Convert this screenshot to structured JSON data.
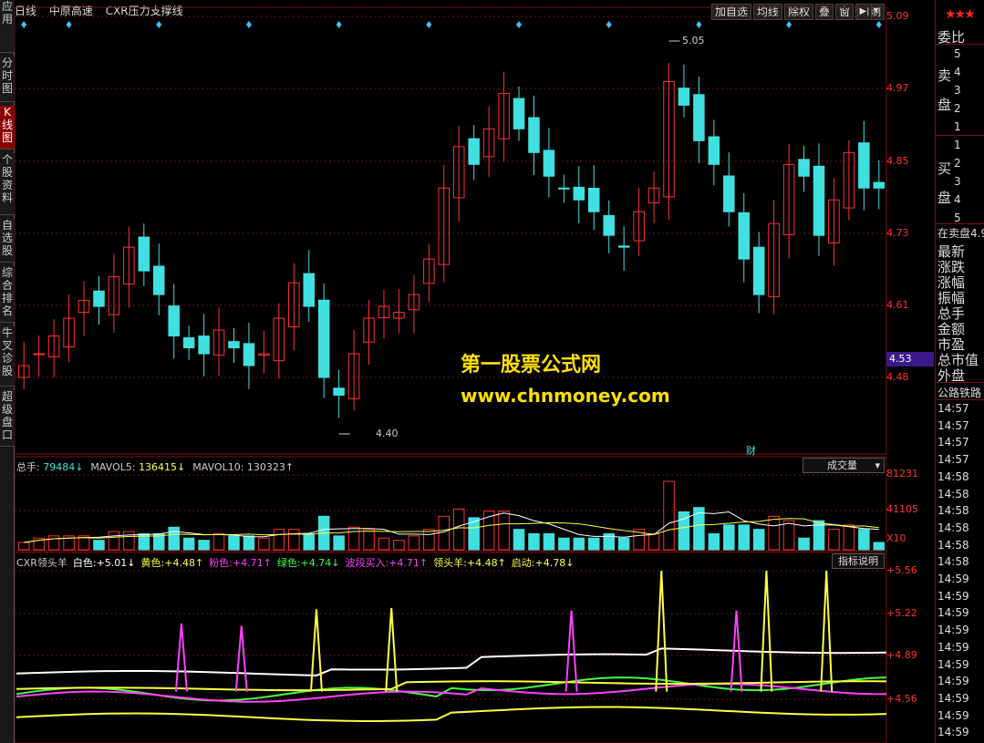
{
  "top": {
    "period": "日线",
    "stock": "中原高速",
    "formula": "CXR压力支撑线"
  },
  "buttons": [
    "加自选",
    "均线",
    "除权",
    "叠",
    "窗",
    "预测"
  ],
  "left_tabs": [
    "应用",
    "分时图",
    "K线图",
    "个股资料",
    "自选股",
    "综合排名",
    "牛叉诊股",
    "超级盘口"
  ],
  "price_axis": [
    "5.09",
    "4.97",
    "4.85",
    "4.73",
    "4.61",
    "4.48"
  ],
  "current_price": "4.53",
  "annotations": {
    "high": "5.05",
    "low": "4.40",
    "cai": "财"
  },
  "volume": {
    "header_items": [
      {
        "label": "总手:",
        "value": "79484↓"
      },
      {
        "label": "MAVOL5:",
        "value": "136415↓"
      },
      {
        "label": "MAVOL10:",
        "value": "130323↑"
      }
    ],
    "axis": [
      "81231",
      "41105",
      "X10"
    ],
    "selector": "成交量"
  },
  "indicator": {
    "name": "CXR领头羊",
    "header_items": [
      {
        "label": "白色:",
        "value": "+5.01↓",
        "color": "#ffffff"
      },
      {
        "label": "黄色:",
        "value": "+4.48↑",
        "color": "#ffff40"
      },
      {
        "label": "粉色:",
        "value": "+4.71↑",
        "color": "#ff40ff"
      },
      {
        "label": "绿色:",
        "value": "+4.74↓",
        "color": "#40ff40"
      },
      {
        "label": "波段买入:",
        "value": "+4.71↑",
        "color": "#ff40ff"
      },
      {
        "label": "领头羊:",
        "value": "+4.48↑",
        "color": "#ffff40"
      },
      {
        "label": "启动:",
        "value": "+4.78↓",
        "color": "#ffff40"
      }
    ],
    "axis": [
      "+5.56",
      "+5.22",
      "+4.89",
      "+4.56"
    ],
    "help": "指标说明"
  },
  "watermark": {
    "line1": "第一股票公式网",
    "line2": "www.chnmoney.com"
  },
  "right_panel": {
    "weibi": "委比",
    "sell_label": [
      "卖",
      "盘"
    ],
    "sell_levels": [
      "5",
      "4",
      "3",
      "2",
      "1"
    ],
    "buy_label": [
      "买",
      "盘"
    ],
    "buy_levels": [
      "1",
      "2",
      "3",
      "4",
      "5"
    ],
    "zaimai": "在卖盘4.9",
    "stats": [
      "最新",
      "涨跌",
      "涨幅",
      "振幅",
      "总手",
      "金额",
      "市盈",
      "总市值",
      "外盘"
    ],
    "ticker_header": "公路铁路",
    "times": [
      "14:57",
      "14:57",
      "14:57",
      "14:57",
      "14:58",
      "14:58",
      "14:58",
      "14:58",
      "14:58",
      "14:58",
      "14:59",
      "14:59",
      "14:59",
      "14:59",
      "14:59",
      "14:59",
      "14:59",
      "14:59",
      "14:59",
      "14:59"
    ]
  },
  "colors": {
    "up": "#ff3030",
    "down": "#40e0e0",
    "grid": "#7a1010",
    "white": "#ffffff",
    "yellow": "#ffff40",
    "pink": "#ff40ff",
    "green": "#40ff40"
  },
  "chart_data": {
    "type": "candlestick",
    "close_estimates": [
      4.5,
      4.52,
      4.55,
      4.58,
      4.61,
      4.6,
      4.65,
      4.7,
      4.66,
      4.62,
      4.55,
      4.53,
      4.52,
      4.56,
      4.53,
      4.5,
      4.52,
      4.58,
      4.64,
      4.6,
      4.48,
      4.45,
      4.52,
      4.58,
      4.6,
      4.59,
      4.62,
      4.68,
      4.8,
      4.87,
      4.84,
      4.9,
      4.96,
      4.9,
      4.86,
      4.82,
      4.8,
      4.78,
      4.76,
      4.72,
      4.7,
      4.76,
      4.8,
      4.98,
      4.94,
      4.88,
      4.84,
      4.76,
      4.68,
      4.62,
      4.74,
      4.84,
      4.82,
      4.72,
      4.78,
      4.86,
      4.8,
      4.8
    ]
  }
}
